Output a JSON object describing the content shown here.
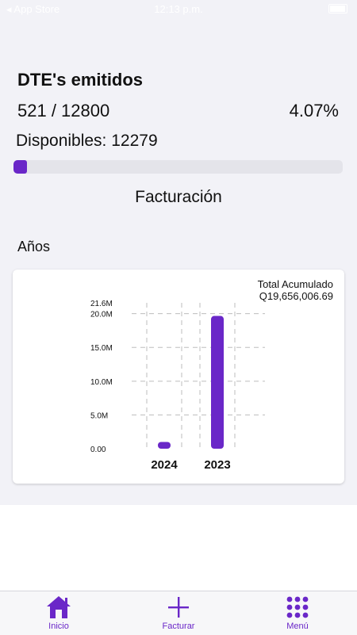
{
  "status": {
    "back_label": "◂ App Store",
    "time": "12:13 p.m."
  },
  "dte": {
    "title": "DTE's emitidos",
    "count": "521 / 12800",
    "percent": "4.07%",
    "available": "Disponibles: 12279",
    "progress_fraction": 0.0407
  },
  "section": {
    "title": "Facturación",
    "years_label": "Años"
  },
  "card": {
    "total_label": "Total Acumulado",
    "total_value": "Q19,656,006.69"
  },
  "chart_data": {
    "type": "bar",
    "categories": [
      "2024",
      "2023"
    ],
    "values": [
      1000000,
      19656006.69
    ],
    "ylim": [
      0,
      21600000
    ],
    "ytick_values": [
      0,
      5000000,
      10000000,
      15000000,
      20000000,
      21600000
    ],
    "ytick_labels": [
      "0.00",
      "5.0M",
      "10.0M",
      "15.0M",
      "20.0M",
      "21.6M"
    ],
    "grid": true,
    "bar_color": "#6a27c8"
  },
  "tabbar": {
    "items": [
      {
        "label": "Inicio",
        "icon": "home-icon"
      },
      {
        "label": "Facturar",
        "icon": "plus-icon"
      },
      {
        "label": "Menú",
        "icon": "grid-icon"
      }
    ]
  },
  "colors": {
    "accent": "#6a27c8",
    "background": "#f2f2f7"
  }
}
